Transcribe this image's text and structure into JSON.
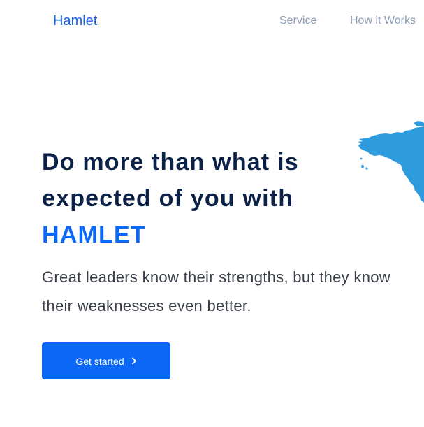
{
  "header": {
    "brand": "Hamlet",
    "nav": [
      {
        "label": "Service"
      },
      {
        "label": "How it Works"
      }
    ]
  },
  "hero": {
    "title_line1": "Do more than what is",
    "title_line2": "expected of you with",
    "title_accent": "HAMLET",
    "subtitle": "Great leaders know their strengths, but they know their weaknesses even better.",
    "cta_label": "Get started",
    "cta_icon": "chevron-right-icon"
  },
  "colors": {
    "brand": "#1565e0",
    "accent": "#0b67f5",
    "heading": "#0b2147",
    "nav": "#8a9bb6",
    "map": "#2f9bdf"
  }
}
